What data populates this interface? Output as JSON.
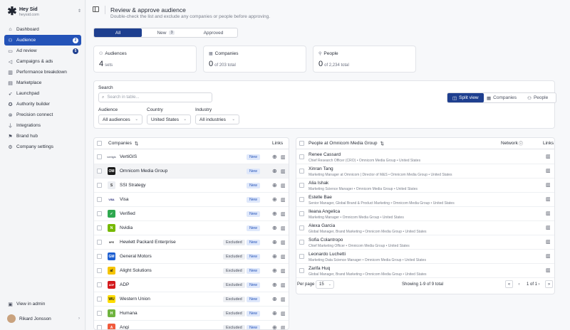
{
  "brand": {
    "name": "Hey Sid",
    "domain": "heysid.com"
  },
  "nav": [
    {
      "label": "Dashboard",
      "icon": "home-icon"
    },
    {
      "label": "Audience",
      "icon": "users-icon",
      "badge": "2",
      "active": true
    },
    {
      "label": "Ad review",
      "icon": "ad-icon",
      "badge": "5"
    },
    {
      "label": "Campaigns & ads",
      "icon": "megaphone-icon"
    },
    {
      "label": "Performance breakdown",
      "icon": "chart-icon"
    },
    {
      "label": "Marketplace",
      "icon": "store-icon"
    },
    {
      "label": "Launchpad",
      "icon": "rocket-icon"
    },
    {
      "label": "Authority builder",
      "icon": "award-icon"
    },
    {
      "label": "Precision connect",
      "icon": "link-icon"
    },
    {
      "label": "Integrations",
      "icon": "plug-icon"
    },
    {
      "label": "Brand hub",
      "icon": "brand-icon"
    },
    {
      "label": "Company settings",
      "icon": "gear-icon"
    }
  ],
  "admin": {
    "label": "View in admin"
  },
  "user": {
    "name": "Rikard Jonsson"
  },
  "header": {
    "title": "Review & approve audience",
    "subtitle": "Double-check the list and exclude any companies or people before approving."
  },
  "tabs": [
    {
      "label": "All",
      "active": true
    },
    {
      "label": "New",
      "count": "3"
    },
    {
      "label": "Approved"
    }
  ],
  "stats": [
    {
      "label": "Audiences",
      "value": "4",
      "suffix": "sets"
    },
    {
      "label": "Companies",
      "value": "0",
      "suffix": "of 203 total"
    },
    {
      "label": "People",
      "value": "0",
      "suffix": "of 2,234 total"
    }
  ],
  "filters": {
    "search_label": "Search",
    "search_placeholder": "Search in table...",
    "audience_label": "Audience",
    "audience_value": "All audiences",
    "country_label": "Country",
    "country_value": "United States",
    "industry_label": "Industry",
    "industry_value": "All industries"
  },
  "views": [
    "Split view",
    "Companies",
    "People"
  ],
  "companies": {
    "header": "Companies",
    "links_header": "Links",
    "rows": [
      {
        "name": "VertiGIS",
        "status": "New",
        "logo_color": "#ffffff",
        "logo_text": "vertigis",
        "logo_fg": "#6b7080"
      },
      {
        "name": "Omnicom Media Group",
        "status": "New",
        "logo_color": "#1a1a1a",
        "logo_text": "OM",
        "logo_fg": "#ffffff"
      },
      {
        "name": "SSI Strategy",
        "status": "New",
        "logo_color": "#eceef2",
        "logo_text": "S",
        "logo_fg": "#333333"
      },
      {
        "name": "Visa",
        "status": "New",
        "logo_color": "#ffffff",
        "logo_text": "VISA",
        "logo_fg": "#1a1f71"
      },
      {
        "name": "Verified",
        "status": "New",
        "logo_color": "#2fa84f",
        "logo_text": "✓",
        "logo_fg": "#ffffff"
      },
      {
        "name": "Nvidia",
        "status": "New",
        "logo_color": "#76b900",
        "logo_text": "N",
        "logo_fg": "#ffffff"
      },
      {
        "name": "Hewlett Packard Enterprise",
        "status": "Excluded",
        "status2": "New",
        "logo_color": "#ffffff",
        "logo_text": "HPE",
        "logo_fg": "#333333"
      },
      {
        "name": "General Motors",
        "status": "Excluded",
        "status2": "New",
        "logo_color": "#1d5fd1",
        "logo_text": "GM",
        "logo_fg": "#ffffff"
      },
      {
        "name": "Alight Solutions",
        "status": "Excluded",
        "status2": "New",
        "logo_color": "#f5c400",
        "logo_text": "al",
        "logo_fg": "#1a1a1a"
      },
      {
        "name": "ADP",
        "status": "Excluded",
        "status2": "New",
        "logo_color": "#d3191c",
        "logo_text": "ADP",
        "logo_fg": "#ffffff"
      },
      {
        "name": "Western Union",
        "status": "Excluded",
        "status2": "New",
        "logo_color": "#ffdd00",
        "logo_text": "WU",
        "logo_fg": "#1a1a1a"
      },
      {
        "name": "Humana",
        "status": "Excluded",
        "status2": "New",
        "logo_color": "#6fb33f",
        "logo_text": "H",
        "logo_fg": "#ffffff"
      },
      {
        "name": "Angi",
        "status": "Excluded",
        "status2": "New",
        "logo_color": "#f05a3c",
        "logo_text": "A",
        "logo_fg": "#ffffff"
      }
    ]
  },
  "people": {
    "header": "People at Omnicom Media Group",
    "network_header": "Network",
    "links_header": "Links",
    "rows": [
      {
        "name": "Renee Cassard",
        "title": "Chief Research Officer (CRO) • Omnicom Media Group • United States"
      },
      {
        "name": "Xinran Tang",
        "title": "Marketing Manager at Omnicom | Director of M&S • Omnicom Media Group • United States"
      },
      {
        "name": "Alia Ishak",
        "title": "Marketing Science Manager • Omnicom Media Group • United States"
      },
      {
        "name": "Estelle Bae",
        "title": "Senior Manager, Global Brand & Product Marketing • Omnicom Media Group • United States"
      },
      {
        "name": "Ileana Angelica",
        "title": "Marketing Manager • Omnicom Media Group • United States"
      },
      {
        "name": "Alexa Garcia",
        "title": "Global Manager, Brand Marketing • Omnicom Media Group • United States"
      },
      {
        "name": "Sofia Colantropo",
        "title": "Chief Marketing Officer • Omnicom Media Group • United States"
      },
      {
        "name": "Leonardo Luchetti",
        "title": "Marketing Data Science Manager • Omnicom Media Group • United States"
      },
      {
        "name": "Zarifa Huq",
        "title": "Global Manager, Brand Marketing • Omnicom Media Group • United States"
      }
    ]
  },
  "pager": {
    "per_page_label": "Per page",
    "per_page_value": "15",
    "showing": "Showing 1-9 of 9 total",
    "page_info": "1 of 1"
  }
}
